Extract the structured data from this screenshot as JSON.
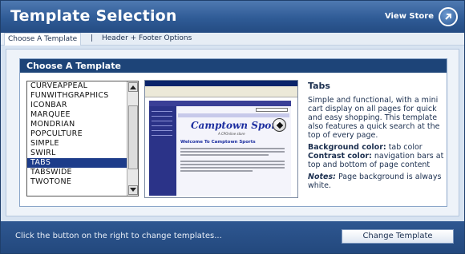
{
  "header": {
    "title": "Template Selection",
    "view_store_label": "View Store",
    "store_icon": "arrow-circle-icon"
  },
  "tabs": {
    "active": "Choose A Template",
    "separator": "|",
    "second": "Header + Footer Options"
  },
  "panel": {
    "title": "Choose A Template"
  },
  "template_list": {
    "items": [
      "CURVEAPPEAL",
      "FUNWITHGRAPHICS",
      "ICONBAR",
      "MARQUEE",
      "MONDRIAN",
      "POPCULTURE",
      "SIMPLE",
      "SWIRL",
      "TABS",
      "TABSWIDE",
      "TWOTONE"
    ],
    "selected": "TABS"
  },
  "preview": {
    "store_name": "Camptown Sports",
    "store_sub": "A CPOnline store",
    "welcome": "Welcome To Camptown Sports"
  },
  "description": {
    "title": "Tabs",
    "body": "Simple and functional, with a mini cart display on all pages for quick and easy shopping. This template also features a quick search at the top of every page.",
    "bg_label": "Background color:",
    "bg_value": " tab color",
    "contrast_label": "Contrast color:",
    "contrast_value": " navigation bars at top and bottom of page content",
    "notes_label": "Notes:",
    "notes_value": " Page background is always white."
  },
  "footer": {
    "instruction": "Click the button on the right to change templates...",
    "button_label": "Change Template"
  },
  "colors": {
    "header_blue": "#2f5b96",
    "panel_title": "#1d4478",
    "selection": "#1d3c8a",
    "footer_blue": "#23487d"
  }
}
